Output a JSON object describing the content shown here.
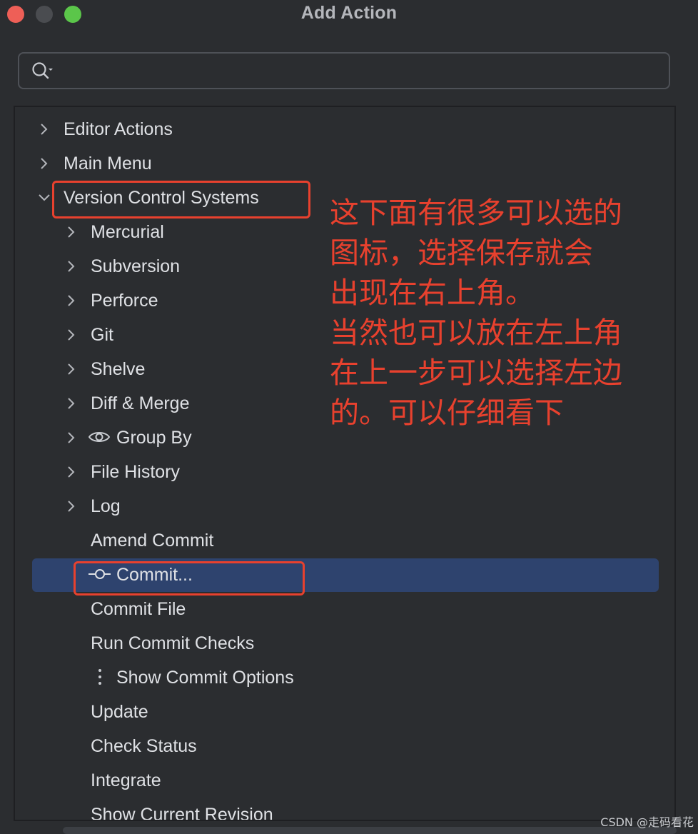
{
  "window": {
    "title": "Add Action"
  },
  "search": {
    "value": "",
    "placeholder": "",
    "icon": "search-icon"
  },
  "tree": {
    "items": [
      {
        "label": "Editor Actions",
        "expandable": true,
        "expanded": false,
        "level": 0
      },
      {
        "label": "Main Menu",
        "expandable": true,
        "expanded": false,
        "level": 0
      },
      {
        "label": "Version Control Systems",
        "expandable": true,
        "expanded": true,
        "level": 0
      },
      {
        "label": "Mercurial",
        "expandable": true,
        "expanded": false,
        "level": 1
      },
      {
        "label": "Subversion",
        "expandable": true,
        "expanded": false,
        "level": 1
      },
      {
        "label": "Perforce",
        "expandable": true,
        "expanded": false,
        "level": 1
      },
      {
        "label": "Git",
        "expandable": true,
        "expanded": false,
        "level": 1
      },
      {
        "label": "Shelve",
        "expandable": true,
        "expanded": false,
        "level": 1
      },
      {
        "label": "Diff & Merge",
        "expandable": true,
        "expanded": false,
        "level": 1
      },
      {
        "label": "Group By",
        "expandable": true,
        "expanded": false,
        "level": 1,
        "icon": "eye-icon"
      },
      {
        "label": "File History",
        "expandable": true,
        "expanded": false,
        "level": 1
      },
      {
        "label": "Log",
        "expandable": true,
        "expanded": false,
        "level": 1
      },
      {
        "label": "Amend Commit",
        "expandable": false,
        "level": 1
      },
      {
        "label": "Commit...",
        "expandable": false,
        "level": 1,
        "icon": "commit-icon",
        "selected": true
      },
      {
        "label": "Commit File",
        "expandable": false,
        "level": 1
      },
      {
        "label": "Run Commit Checks",
        "expandable": false,
        "level": 1
      },
      {
        "label": "Show Commit Options",
        "expandable": false,
        "level": 1,
        "icon": "vertical-ellipsis-icon"
      },
      {
        "label": "Update",
        "expandable": false,
        "level": 1
      },
      {
        "label": "Check Status",
        "expandable": false,
        "level": 1
      },
      {
        "label": "Integrate",
        "expandable": false,
        "level": 1
      },
      {
        "label": "Show Current Revision",
        "expandable": false,
        "level": 1
      }
    ]
  },
  "annotation": {
    "lines": [
      "这下面有很多可以选的",
      "图标，选择保存就会",
      "出现在右上角。",
      "当然也可以放在左上角",
      "在上一步可以选择左边",
      "的。可以仔细看下"
    ],
    "color": "#e8412e"
  },
  "watermark": "CSDN @走码看花",
  "colors": {
    "background": "#2b2d30",
    "selection": "#2e436e",
    "text": "#dfe1e5",
    "annotation": "#e8412e"
  }
}
